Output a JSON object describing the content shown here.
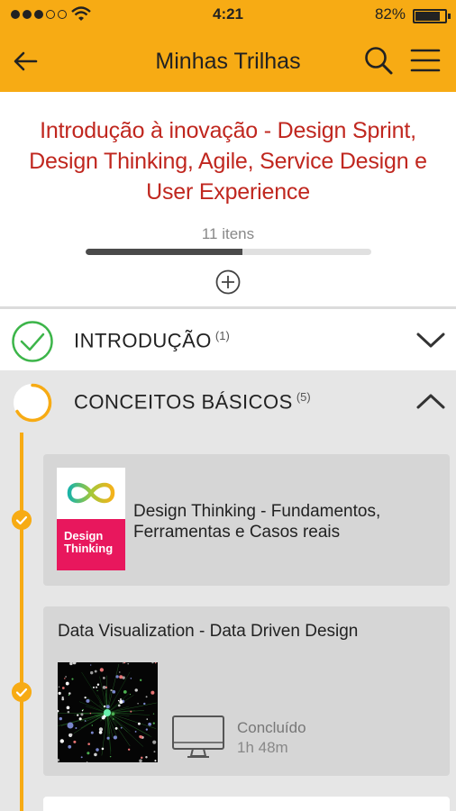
{
  "status_bar": {
    "time": "4:21",
    "battery": "82%"
  },
  "header": {
    "title": "Minhas Trilhas"
  },
  "course": {
    "title_lines": [
      "Introdução à inovação - Design Sprint,",
      "Design Thinking, Agile, Service Design e",
      "User Experience"
    ],
    "items_count": "11 itens",
    "progress": 0.55
  },
  "sections": [
    {
      "label": "INTRODUÇÃO",
      "count": "(1)",
      "status": "complete",
      "expanded": false
    },
    {
      "label": "CONCEITOS BÁSICOS",
      "count": "(5)",
      "status": "in-progress",
      "expanded": true
    }
  ],
  "lessons": [
    {
      "title_lines": [
        "Design Thinking - Fundamentos,",
        "Ferramentas e Casos reais"
      ],
      "thumb_text_lines": [
        "Design",
        "Thinking"
      ]
    },
    {
      "title": "Data Visualization - Data Driven Design",
      "status": "Concluído",
      "duration": "1h 48m"
    }
  ],
  "colors": {
    "accent": "#f7ab14",
    "title_red": "#c0271f",
    "thumb_pink": "#e8175d",
    "check_green": "#3db54a"
  }
}
